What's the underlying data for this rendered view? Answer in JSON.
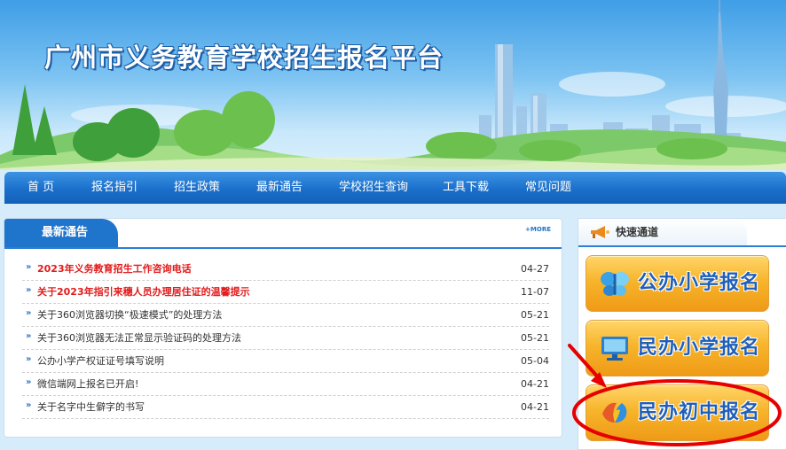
{
  "site": {
    "title": "广州市义务教育学校招生报名平台"
  },
  "nav": {
    "items": [
      "首 页",
      "报名指引",
      "招生政策",
      "最新通告",
      "学校招生查询",
      "工具下载",
      "常见问题"
    ]
  },
  "news": {
    "title": "最新通告",
    "more_label": "+MORE",
    "items": [
      {
        "title": "2023年义务教育招生工作咨询电话",
        "date": "04-27",
        "hot": true
      },
      {
        "title": "关于2023年指引来穗人员办理居住证的温馨提示",
        "date": "11-07",
        "hot": true
      },
      {
        "title": "关于360浏览器切换“极速模式”的处理方法",
        "date": "05-21",
        "hot": false
      },
      {
        "title": "关于360浏览器无法正常显示验证码的处理方法",
        "date": "05-21",
        "hot": false
      },
      {
        "title": "公办小学产权证证号填写说明",
        "date": "05-04",
        "hot": false
      },
      {
        "title": "微信端网上报名已开启!",
        "date": "04-21",
        "hot": false
      },
      {
        "title": "关于名字中生僻字的书写",
        "date": "04-21",
        "hot": false
      }
    ]
  },
  "quick": {
    "title": "快速通道",
    "buttons": [
      "公办小学报名",
      "民办小学报名",
      "民办初中报名"
    ]
  },
  "colors": {
    "accent": "#1f74cc",
    "hot_text": "#e21b1b",
    "button_gold": "#f7b52c",
    "annotation_red": "#e60000"
  }
}
